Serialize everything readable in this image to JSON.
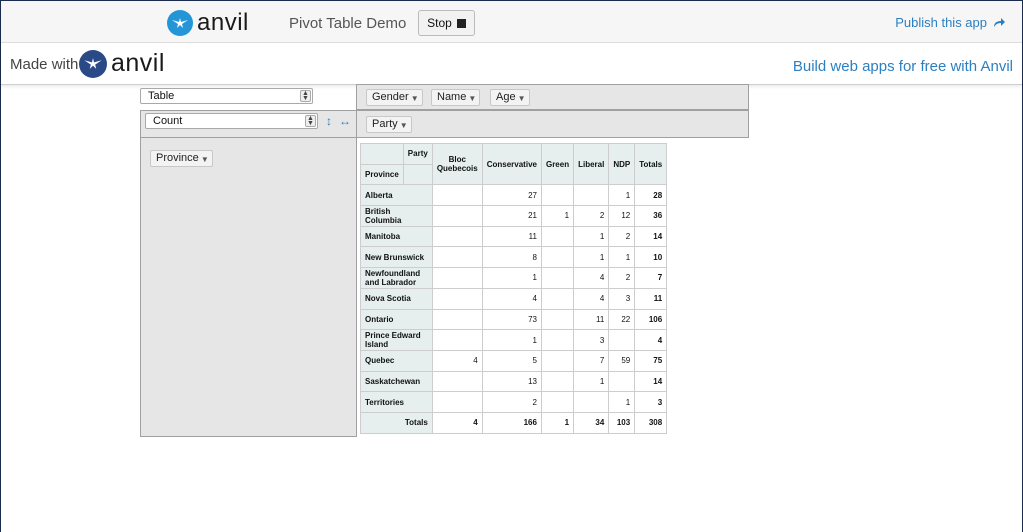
{
  "topbar": {
    "logo_word": "anvil",
    "app_title": "Pivot Table Demo",
    "stop_label": "Stop",
    "publish_label": "Publish this app"
  },
  "madebar": {
    "made_with": "Made with",
    "logo_word": "anvil",
    "build_link": "Build web apps for free with Anvil"
  },
  "colors": {
    "accent": "#2c7fc1",
    "logo_blue": "#2495d6",
    "header_bg": "#e6eeee",
    "panel_bg": "#e6e6e6"
  },
  "pivot": {
    "renderer_select": "Table",
    "aggregator_select": "Count",
    "unused_attrs": [
      "Gender",
      "Name",
      "Age"
    ],
    "col_attrs": [
      "Party"
    ],
    "row_attrs": [
      "Province"
    ],
    "col_attr_header": "Party",
    "row_attr_header": "Province",
    "columns": [
      "Bloc Quebecois",
      "Conservative",
      "Green",
      "Liberal",
      "NDP"
    ],
    "totals_label": "Totals",
    "rows": [
      {
        "label": "Alberta",
        "values": [
          "",
          "27",
          "",
          "",
          "1"
        ],
        "total": "28"
      },
      {
        "label": "British Columbia",
        "values": [
          "",
          "21",
          "1",
          "2",
          "12"
        ],
        "total": "36"
      },
      {
        "label": "Manitoba",
        "values": [
          "",
          "11",
          "",
          "1",
          "2"
        ],
        "total": "14"
      },
      {
        "label": "New Brunswick",
        "values": [
          "",
          "8",
          "",
          "1",
          "1"
        ],
        "total": "10"
      },
      {
        "label": "Newfoundland and Labrador",
        "values": [
          "",
          "1",
          "",
          "4",
          "2"
        ],
        "total": "7"
      },
      {
        "label": "Nova Scotia",
        "values": [
          "",
          "4",
          "",
          "4",
          "3"
        ],
        "total": "11"
      },
      {
        "label": "Ontario",
        "values": [
          "",
          "73",
          "",
          "11",
          "22"
        ],
        "total": "106"
      },
      {
        "label": "Prince Edward Island",
        "values": [
          "",
          "1",
          "",
          "3",
          ""
        ],
        "total": "4"
      },
      {
        "label": "Quebec",
        "values": [
          "4",
          "5",
          "",
          "7",
          "59"
        ],
        "total": "75"
      },
      {
        "label": "Saskatchewan",
        "values": [
          "",
          "13",
          "",
          "1",
          ""
        ],
        "total": "14"
      },
      {
        "label": "Territories",
        "values": [
          "",
          "2",
          "",
          "",
          "1"
        ],
        "total": "3"
      }
    ],
    "col_totals": [
      "4",
      "166",
      "1",
      "34",
      "103"
    ],
    "grand_total": "308"
  }
}
